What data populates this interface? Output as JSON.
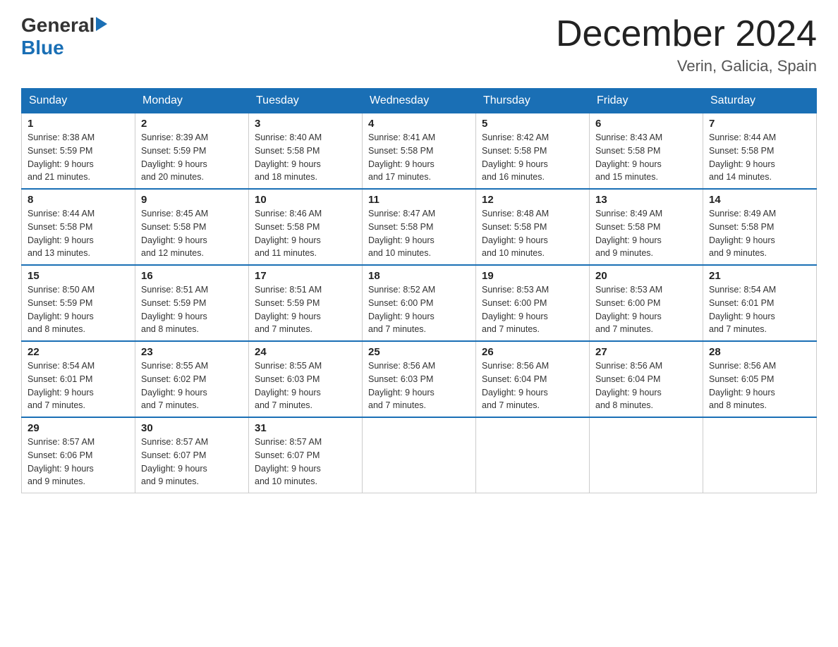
{
  "header": {
    "logo_general": "General",
    "logo_blue": "Blue",
    "title": "December 2024",
    "subtitle": "Verin, Galicia, Spain"
  },
  "weekdays": [
    "Sunday",
    "Monday",
    "Tuesday",
    "Wednesday",
    "Thursday",
    "Friday",
    "Saturday"
  ],
  "weeks": [
    [
      {
        "day": "1",
        "sunrise": "8:38 AM",
        "sunset": "5:59 PM",
        "daylight": "9 hours and 21 minutes."
      },
      {
        "day": "2",
        "sunrise": "8:39 AM",
        "sunset": "5:59 PM",
        "daylight": "9 hours and 20 minutes."
      },
      {
        "day": "3",
        "sunrise": "8:40 AM",
        "sunset": "5:58 PM",
        "daylight": "9 hours and 18 minutes."
      },
      {
        "day": "4",
        "sunrise": "8:41 AM",
        "sunset": "5:58 PM",
        "daylight": "9 hours and 17 minutes."
      },
      {
        "day": "5",
        "sunrise": "8:42 AM",
        "sunset": "5:58 PM",
        "daylight": "9 hours and 16 minutes."
      },
      {
        "day": "6",
        "sunrise": "8:43 AM",
        "sunset": "5:58 PM",
        "daylight": "9 hours and 15 minutes."
      },
      {
        "day": "7",
        "sunrise": "8:44 AM",
        "sunset": "5:58 PM",
        "daylight": "9 hours and 14 minutes."
      }
    ],
    [
      {
        "day": "8",
        "sunrise": "8:44 AM",
        "sunset": "5:58 PM",
        "daylight": "9 hours and 13 minutes."
      },
      {
        "day": "9",
        "sunrise": "8:45 AM",
        "sunset": "5:58 PM",
        "daylight": "9 hours and 12 minutes."
      },
      {
        "day": "10",
        "sunrise": "8:46 AM",
        "sunset": "5:58 PM",
        "daylight": "9 hours and 11 minutes."
      },
      {
        "day": "11",
        "sunrise": "8:47 AM",
        "sunset": "5:58 PM",
        "daylight": "9 hours and 10 minutes."
      },
      {
        "day": "12",
        "sunrise": "8:48 AM",
        "sunset": "5:58 PM",
        "daylight": "9 hours and 10 minutes."
      },
      {
        "day": "13",
        "sunrise": "8:49 AM",
        "sunset": "5:58 PM",
        "daylight": "9 hours and 9 minutes."
      },
      {
        "day": "14",
        "sunrise": "8:49 AM",
        "sunset": "5:58 PM",
        "daylight": "9 hours and 9 minutes."
      }
    ],
    [
      {
        "day": "15",
        "sunrise": "8:50 AM",
        "sunset": "5:59 PM",
        "daylight": "9 hours and 8 minutes."
      },
      {
        "day": "16",
        "sunrise": "8:51 AM",
        "sunset": "5:59 PM",
        "daylight": "9 hours and 8 minutes."
      },
      {
        "day": "17",
        "sunrise": "8:51 AM",
        "sunset": "5:59 PM",
        "daylight": "9 hours and 7 minutes."
      },
      {
        "day": "18",
        "sunrise": "8:52 AM",
        "sunset": "6:00 PM",
        "daylight": "9 hours and 7 minutes."
      },
      {
        "day": "19",
        "sunrise": "8:53 AM",
        "sunset": "6:00 PM",
        "daylight": "9 hours and 7 minutes."
      },
      {
        "day": "20",
        "sunrise": "8:53 AM",
        "sunset": "6:00 PM",
        "daylight": "9 hours and 7 minutes."
      },
      {
        "day": "21",
        "sunrise": "8:54 AM",
        "sunset": "6:01 PM",
        "daylight": "9 hours and 7 minutes."
      }
    ],
    [
      {
        "day": "22",
        "sunrise": "8:54 AM",
        "sunset": "6:01 PM",
        "daylight": "9 hours and 7 minutes."
      },
      {
        "day": "23",
        "sunrise": "8:55 AM",
        "sunset": "6:02 PM",
        "daylight": "9 hours and 7 minutes."
      },
      {
        "day": "24",
        "sunrise": "8:55 AM",
        "sunset": "6:03 PM",
        "daylight": "9 hours and 7 minutes."
      },
      {
        "day": "25",
        "sunrise": "8:56 AM",
        "sunset": "6:03 PM",
        "daylight": "9 hours and 7 minutes."
      },
      {
        "day": "26",
        "sunrise": "8:56 AM",
        "sunset": "6:04 PM",
        "daylight": "9 hours and 7 minutes."
      },
      {
        "day": "27",
        "sunrise": "8:56 AM",
        "sunset": "6:04 PM",
        "daylight": "9 hours and 8 minutes."
      },
      {
        "day": "28",
        "sunrise": "8:56 AM",
        "sunset": "6:05 PM",
        "daylight": "9 hours and 8 minutes."
      }
    ],
    [
      {
        "day": "29",
        "sunrise": "8:57 AM",
        "sunset": "6:06 PM",
        "daylight": "9 hours and 9 minutes."
      },
      {
        "day": "30",
        "sunrise": "8:57 AM",
        "sunset": "6:07 PM",
        "daylight": "9 hours and 9 minutes."
      },
      {
        "day": "31",
        "sunrise": "8:57 AM",
        "sunset": "6:07 PM",
        "daylight": "9 hours and 10 minutes."
      },
      null,
      null,
      null,
      null
    ]
  ],
  "labels": {
    "sunrise": "Sunrise:",
    "sunset": "Sunset:",
    "daylight": "Daylight:"
  }
}
